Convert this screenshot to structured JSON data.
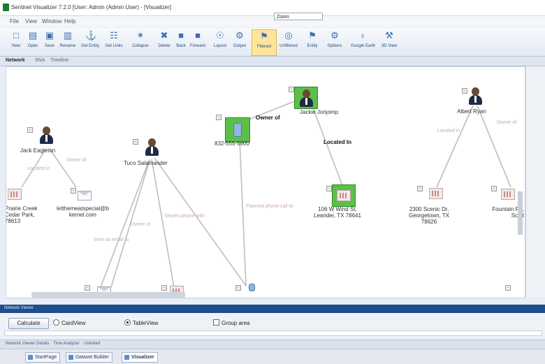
{
  "window": {
    "title": "Sentinel Visualizer 7.2.0 [User: Admin (Admin User) - [Visualizer]"
  },
  "menu": [
    "File",
    "View",
    "Window",
    "Help"
  ],
  "toolbar": [
    {
      "label": "New",
      "icon": "new-icon",
      "glyph": "□"
    },
    {
      "label": "Open",
      "icon": "open-icon",
      "glyph": "▤"
    },
    {
      "label": "Save",
      "icon": "save-icon",
      "glyph": "▣"
    },
    {
      "label": "Rename",
      "icon": "rename-icon",
      "glyph": "▥"
    },
    {
      "label": "Get Entity",
      "icon": "get-entity-icon",
      "glyph": "⚓"
    },
    {
      "label": "Get Links",
      "icon": "get-links-icon",
      "glyph": "☷"
    },
    {
      "label": "Collapse",
      "icon": "collapse-icon",
      "glyph": "✶"
    },
    {
      "label": "Delete",
      "icon": "delete-icon",
      "glyph": "✖"
    },
    {
      "label": "Back",
      "icon": "back-icon",
      "glyph": "■"
    },
    {
      "label": "Forward",
      "icon": "forward-icon",
      "glyph": "■"
    },
    {
      "label": "Layout",
      "icon": "layout-icon",
      "glyph": "☉"
    },
    {
      "label": "Output",
      "icon": "output-icon",
      "glyph": "⚙"
    },
    {
      "label": "Filtered",
      "icon": "filter-icon",
      "glyph": "⚑",
      "active": true
    },
    {
      "label": "Unfiltered",
      "icon": "unfiltered-icon",
      "glyph": "◎"
    },
    {
      "label": "Entity",
      "icon": "entity-icon",
      "glyph": "⚑"
    },
    {
      "label": "Options",
      "icon": "options-icon",
      "glyph": "⚙"
    },
    {
      "label": "Google Earth",
      "icon": "google-earth-icon",
      "glyph": "♁"
    },
    {
      "label": "3D View",
      "icon": "3d-view-icon",
      "glyph": "⚒"
    }
  ],
  "zoom": {
    "label": "Zoom"
  },
  "doc_tabs": [
    "Network",
    "SNA",
    "Timeline"
  ],
  "graph": {
    "nodes": {
      "jack": "Jack Eagleton",
      "tuco": "Tuco Salamander",
      "phone": "832-555-5900",
      "jackie": "Jackie Jonjomp",
      "albert": "Albert Ryan",
      "addr_left_1": "Prairie Creek",
      "addr_left_2": "Cedar Park,",
      "addr_left_3": "78613",
      "email_1": "letthemeatspecial@b",
      "email_2": "kernel.com",
      "addr_mid_1": "106 W Wind St,",
      "addr_mid_2": "Leander, TX 78641",
      "addr_right_1": "2300 Scenic Dr,",
      "addr_right_2": "Georgetown, TX",
      "addr_right_3": "78626",
      "addr_far_1": "Fountain Rd,",
      "addr_far_2": "Scott"
    },
    "edges": {
      "owner_of": "Owner of",
      "located_in": "Located In",
      "located_in_faint": "Located in",
      "owner_of_faint": "Owner of",
      "owner_of_tuco": "Owner of",
      "sent_email": "Sent an email to",
      "shares_phone": "Shares phone with",
      "planet": "Planned phone call to",
      "owner_far": "Owner of"
    }
  },
  "network_view": {
    "header": "Network Viewer",
    "calculate": "Calculate",
    "options": [
      {
        "label": "CardView",
        "type": "radio",
        "checked": false
      },
      {
        "label": "TableView",
        "type": "radio",
        "checked": true
      },
      {
        "label": "Group area",
        "type": "checkbox",
        "checked": false
      }
    ]
  },
  "bottom_tabs": [
    "Network Viewer",
    "Details",
    "Time Analyzer",
    "Unlinked"
  ],
  "taskbar": [
    {
      "label": "StartPage",
      "selected": false
    },
    {
      "label": "Dataset Builder",
      "selected": false
    },
    {
      "label": "Visualizer",
      "selected": true
    }
  ]
}
